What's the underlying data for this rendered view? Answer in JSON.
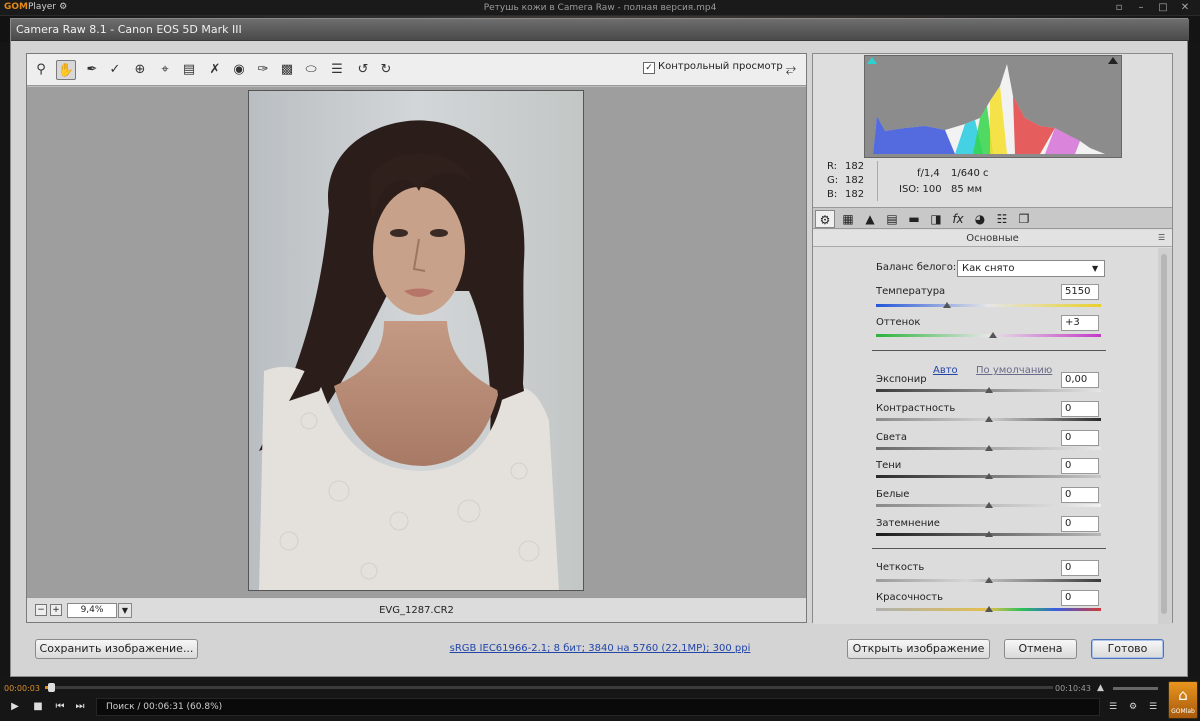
{
  "gom": {
    "logo": "GOM",
    "logo_suffix": "Player",
    "logo_gear": "⚙",
    "filename": "Ретушь кожи в Camera Raw - полная версия.mp4",
    "current_time": "00:00:03",
    "total_time": "00:10:43",
    "status": "Поиск / 00:06:31 (60.8%)",
    "seek_progress": 0.005,
    "home_label": "GOMlab"
  },
  "acr": {
    "title": "Camera Raw 8.1  -  Canon EOS 5D Mark III",
    "preview_label": "Контрольный просмотр",
    "preview_checked": "✓",
    "zoom": "9,4%",
    "filename": "EVG_1287.CR2",
    "workflow": "sRGB IEC61966-2.1; 8 бит; 3840 на 5760 (22,1MP); 300 ppi",
    "buttons": {
      "save": "Сохранить изображение...",
      "open": "Открыть изображение",
      "cancel": "Отмена",
      "done": "Готово"
    }
  },
  "info": {
    "r_label": "R:",
    "r": "182",
    "g_label": "G:",
    "g": "182",
    "b_label": "B:",
    "b": "182",
    "aperture": "f/1,4",
    "shutter": "1/640 с",
    "iso": "ISO: 100",
    "focal": "85 мм"
  },
  "panel": {
    "title": "Основные",
    "wb_label": "Баланс белого:",
    "wb_value": "Как снято",
    "temperature_label": "Температура",
    "temperature": "5150",
    "tint_label": "Оттенок",
    "tint": "+3",
    "auto": "Авто",
    "default": "По умолчанию",
    "sliders": [
      {
        "label": "Экспониp",
        "value": "0,00"
      },
      {
        "label": "Контрастность",
        "value": "0"
      },
      {
        "label": "Света",
        "value": "0"
      },
      {
        "label": "Тени",
        "value": "0"
      },
      {
        "label": "Белые",
        "value": "0"
      },
      {
        "label": "Затемнение",
        "value": "0"
      }
    ],
    "clarity_label": "Четкость",
    "clarity": "0",
    "vibrance_label": "Красочность",
    "vibrance": "0"
  },
  "colors": {
    "accent": "#e38a1c",
    "link": "#2245a8",
    "default_button_border": "#4d74b8"
  }
}
